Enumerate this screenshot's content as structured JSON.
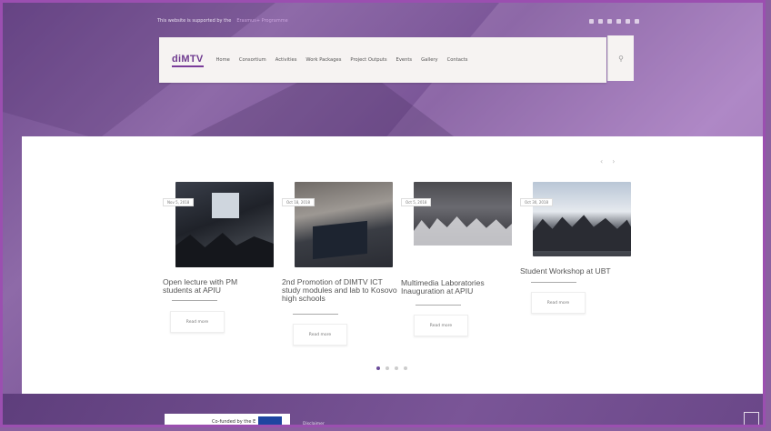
{
  "topbar": {
    "text": "This website is supported by the",
    "link": "Erasmus+ Programme",
    "social_icons": [
      "facebook-icon",
      "twitter-icon",
      "pinterest-icon",
      "youtube-icon",
      "linkedin-icon",
      "google-icon"
    ]
  },
  "nav": {
    "logo": "diMTV",
    "menu": [
      "Home",
      "Consortium",
      "Activities",
      "Work Packages",
      "Project Outputs",
      "Events",
      "Gallery",
      "Contacts"
    ]
  },
  "slider": {
    "cards": [
      {
        "date": "Nov 5, 2018",
        "title": "Open lecture with PM students at APIU",
        "button": "Read more"
      },
      {
        "date": "Oct 18, 2018",
        "title": "2nd Promotion of DIMTV ICT study modules and lab to Kosovo high schools",
        "button": "Read more"
      },
      {
        "date": "Oct 5, 2018",
        "title": "Multimedia Laboratories Inauguration at APIU",
        "button": "Read more"
      },
      {
        "date": "Oct 30, 2018",
        "title": "Student Workshop at UBT",
        "button": "Read more"
      }
    ],
    "prev": "‹",
    "next": "›",
    "dots": 4,
    "active_dot": 0
  },
  "footer": {
    "eu_text": "Co-funded by the Erasmus+ Programme of the European Union",
    "disclaimer": "Disclaimer"
  },
  "colors": {
    "accent": "#6e3a8f",
    "frame": "#9b4fb0",
    "background": "#8a5fa0"
  }
}
